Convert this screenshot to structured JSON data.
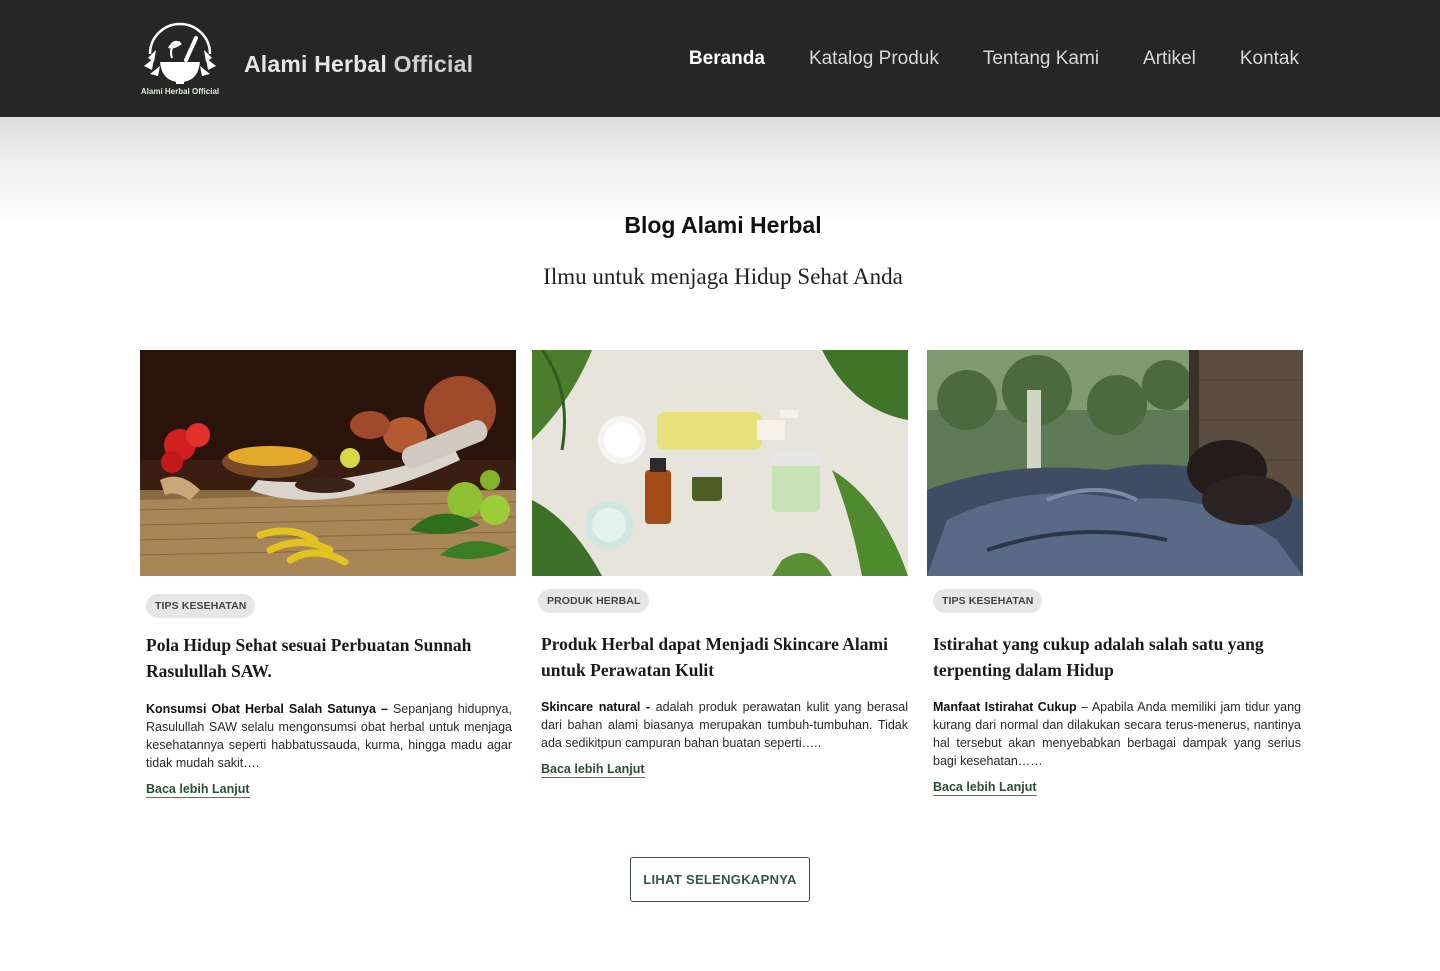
{
  "header": {
    "logo_caption": "Alami Herbal Official",
    "brand_part1": "Alami Herbal ",
    "brand_part2": "Official",
    "nav": [
      {
        "label": "Beranda",
        "active": true
      },
      {
        "label": "Katalog Produk",
        "active": false
      },
      {
        "label": "Tentang Kami",
        "active": false
      },
      {
        "label": "Artikel",
        "active": false
      },
      {
        "label": "Kontak",
        "active": false
      }
    ]
  },
  "section": {
    "title": "Blog Alami Herbal",
    "subtitle": "Ilmu untuk menjaga Hidup Sehat Anda"
  },
  "cards": [
    {
      "image": "herbal-spices-mortar-photo",
      "badge": "TIPS KESEHATAN",
      "title": "Pola Hidup Sehat sesuai Perbuatan Sunnah Rasulullah SAW.",
      "lead": "Konsumsi Obat Herbal Salah Satunya –",
      "text": " Sepanjang hidupnya, Rasulullah SAW selalu mengonsumsi obat herbal untuk menjaga kesehatannya seperti habbatussauda, kurma, hingga madu agar tidak mudah sakit….",
      "link": "Baca lebih Lanjut"
    },
    {
      "image": "skincare-bottles-leaves-photo",
      "badge": "PRODUK HERBAL",
      "title": "Produk Herbal dapat Menjadi Skincare Alami untuk Perawatan Kulit",
      "lead": "Skincare natural -",
      "text": " adalah produk perawatan kulit yang berasal dari bahan alami biasanya merupakan tumbuh-tumbuhan. Tidak ada sedikitpun campuran bahan buatan seperti…..",
      "link": "Baca lebih Lanjut"
    },
    {
      "image": "person-sleeping-bed-photo",
      "badge": "TIPS KESEHATAN",
      "title": "Istirahat yang cukup adalah salah satu yang terpenting dalam Hidup",
      "lead": "Manfaat Istirahat Cukup",
      "text": " – Apabila Anda memiliki jam tidur yang kurang dari normal dan dilakukan secara terus-menerus, nantinya hal tersebut akan menyebabkan berbagai dampak yang serius bagi kesehatan……",
      "link": "Baca lebih Lanjut"
    }
  ],
  "see_more_button": "LIHAT SELENGKAPNYA"
}
